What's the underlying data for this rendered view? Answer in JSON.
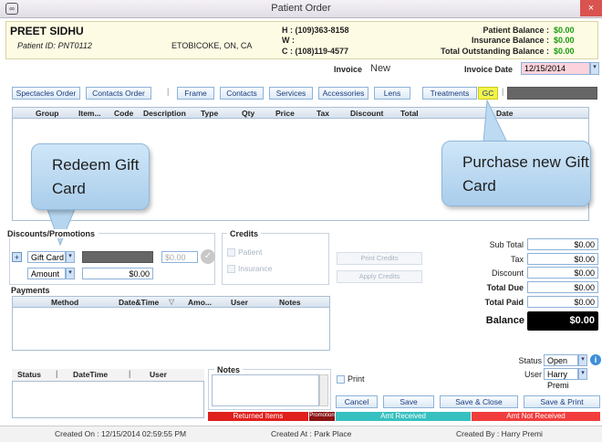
{
  "window": {
    "title": "Patient Order",
    "close_label": "×",
    "app_icon": "glasses-icon"
  },
  "patient": {
    "name": "PREET SIDHU",
    "id_line": "Patient ID: PNT0112",
    "location": "ETOBICOKE, ON, CA",
    "home_phone": "H : (109)363-8158",
    "work_phone": "W :",
    "cell_phone": "C : (108)119-4577",
    "patient_balance_label": "Patient Balance :",
    "patient_balance": "$0.00",
    "insurance_balance_label": "Insurance Balance :",
    "insurance_balance": "$0.00",
    "total_outstanding_label": "Total Outstanding Balance :",
    "total_outstanding": "$0.00"
  },
  "invoice": {
    "label": "Invoice",
    "value": "New",
    "date_label": "Invoice Date",
    "date": "12/15/2014"
  },
  "tabs": [
    "Spectacles Order",
    "Contacts Order",
    "Frame",
    "Contacts",
    "Services",
    "Accessories",
    "Lens",
    "Treatments",
    "GC"
  ],
  "grid": {
    "columns": [
      "Group",
      "Item...",
      "Code",
      "Description",
      "Type",
      "Qty",
      "Price",
      "Tax",
      "Discount",
      "Total",
      "Date"
    ]
  },
  "callouts": {
    "redeem": "Redeem Gift Card",
    "purchase": "Purchase new Gift Card"
  },
  "discounts": {
    "title": "Discounts/Promotions",
    "type_value": "Gift Card",
    "amount_field": "$0.00",
    "amount_label": "Amount",
    "amount_value": "$0.00"
  },
  "credits": {
    "title": "Credits",
    "patient": "Patient",
    "insurance": "Insurance",
    "print_credits": "Print Credits",
    "apply_credits": "Apply Credits"
  },
  "totals": {
    "sub_total_label": "Sub Total",
    "sub_total": "$0.00",
    "tax_label": "Tax",
    "tax": "$0.00",
    "discount_label": "Discount",
    "discount": "$0.00",
    "total_due_label": "Total Due",
    "total_due": "$0.00",
    "total_paid_label": "Total Paid",
    "total_paid": "$0.00",
    "balance_label": "Balance",
    "balance": "$0.00"
  },
  "payments": {
    "title": "Payments",
    "columns": [
      "Method",
      "Date&Time",
      "Amo...",
      "User",
      "Notes"
    ]
  },
  "status_log": {
    "columns": [
      "Status",
      "DateTime",
      "User"
    ]
  },
  "notes": {
    "title": "Notes",
    "print_label": "Print"
  },
  "order_status": {
    "status_label": "Status",
    "status_value": "Open",
    "user_label": "User",
    "user_value": "Harry Premi"
  },
  "actions": {
    "cancel": "Cancel",
    "save": "Save",
    "save_close": "Save & Close",
    "save_print": "Save & Print"
  },
  "legend": {
    "returned": "Returned Items",
    "promotion": "Promotion",
    "amt_received": "Amt Received",
    "amt_not_received": "Amt Not Received"
  },
  "footer": {
    "created_on": "Created On : 12/15/2014 02:59:55 PM",
    "created_at": "Created At : Park Place",
    "created_by": "Created By : Harry Premi"
  }
}
